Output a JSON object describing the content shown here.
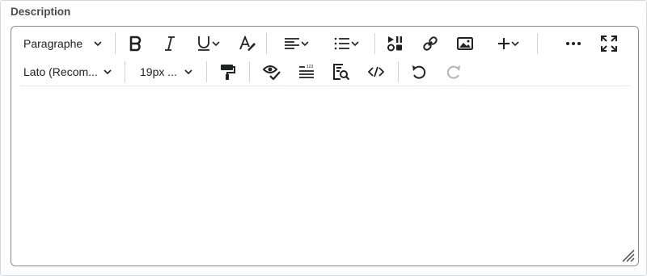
{
  "field": {
    "label": "Description"
  },
  "toolbar": {
    "format_block": "Paragraphe",
    "font_family": "Lato (Recom...",
    "font_size": "19px ..."
  },
  "editor": {
    "content": ""
  },
  "colors": {
    "icon": "#202122",
    "icon_disabled": "#b1b4b7",
    "border": "#8a8c8e",
    "label": "#494c4e"
  }
}
